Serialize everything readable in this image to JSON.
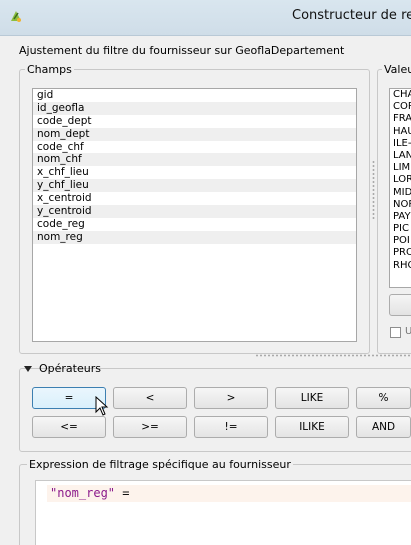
{
  "window": {
    "title": "Constructeur de re"
  },
  "heading": "Ajustement du filtre du fournisseur sur GeoflaDepartement",
  "fields_group": {
    "title": "Champs",
    "items": [
      "gid",
      "id_geofla",
      "code_dept",
      "nom_dept",
      "code_chf",
      "nom_chf",
      "x_chf_lieu",
      "y_chf_lieu",
      "x_centroid",
      "y_centroid",
      "code_reg",
      "nom_reg"
    ]
  },
  "values_group": {
    "title": "Valeur",
    "items": [
      "CHA",
      "COR",
      "FRA",
      "HAU",
      "ILE-",
      "LAN",
      "LIM",
      "LOR",
      "MID",
      "NOR",
      "PAY",
      "PIC",
      "POI",
      "PRO",
      "RHO"
    ],
    "checkbox_label": "U"
  },
  "operators": {
    "title": "Opérateurs",
    "row1": [
      "=",
      "<",
      ">",
      "LIKE",
      "%"
    ],
    "row2": [
      "<=",
      ">=",
      "!=",
      "ILIKE",
      "AND"
    ]
  },
  "expression": {
    "title": "Expression de filtrage spécifique au fournisseur",
    "field": "\"nom_reg\"",
    "operator": " ="
  }
}
